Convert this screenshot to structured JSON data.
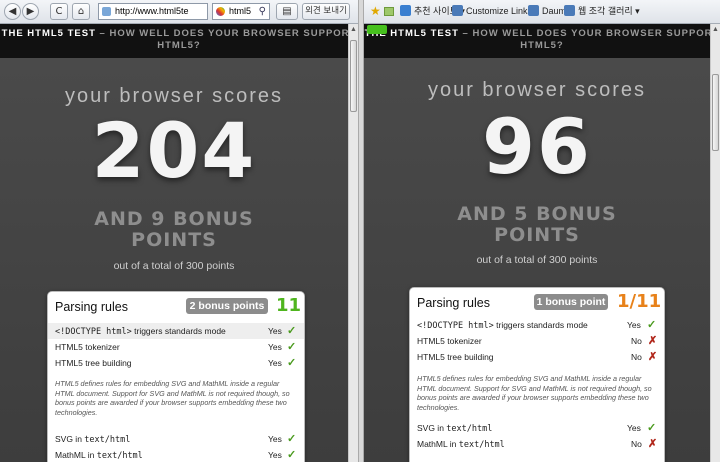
{
  "colors": {
    "green": "#4fb51e",
    "orange": "#e8821a",
    "cross": "#b1271b",
    "check": "#4a9a1e"
  },
  "left": {
    "toolbar": {
      "back": "◀",
      "forward": "▶",
      "refresh": "C",
      "home": "⌂",
      "address": "http://www.html5te",
      "search": "html5",
      "page_menu": "외견 보내기"
    },
    "banner": {
      "strong": "THE HTML5 TEST",
      "rest": " – HOW WELL DOES YOUR BROWSER SUPPORT HTML5?"
    },
    "scores_label": "your browser scores",
    "score": "204",
    "bonus_line1": "AND 9 BONUS",
    "bonus_line2": "POINTS",
    "total": "out of a total of 300 points",
    "card": {
      "title": "Parsing rules",
      "bonus_badge": "2 bonus points",
      "score": "11",
      "rows": [
        {
          "label_code": "<!DOCTYPE html>",
          "label_rest": " triggers standards mode",
          "result": "Yes",
          "mark": "✓"
        },
        {
          "label": "HTML5 tokenizer",
          "result": "Yes",
          "mark": "✓"
        },
        {
          "label": "HTML5 tree building",
          "result": "Yes",
          "mark": "✓"
        }
      ],
      "note": "HTML5 defines rules for embedding SVG and MathML inside a regular HTML document. Support for SVG and MathML is not required though, so bonus points are awarded if your browser supports embedding these two technologies.",
      "rows2": [
        {
          "label_pre": "SVG in ",
          "label_code": "text/html",
          "result": "Yes",
          "mark": "✓"
        },
        {
          "label_pre": "MathML in ",
          "label_code": "text/html",
          "result": "Yes",
          "mark": "✓"
        }
      ]
    }
  },
  "right": {
    "favorites": [
      {
        "label": "추천 사이트 ▾",
        "icon_color": "#3a7fd0"
      },
      {
        "label": "Customize Links",
        "icon_color": "#4a7ab8"
      },
      {
        "label": "Daum",
        "icon_color": "#4a7ab8"
      },
      {
        "label": "웹 조각 갤러리 ▾",
        "icon_color": "#4a7ab8"
      }
    ],
    "banner": {
      "strong": "THE HTML5 TEST",
      "rest": " – HOW WELL DOES YOUR BROWSER SUPPORT HTML5?"
    },
    "scores_label": "your browser scores",
    "score": "96",
    "bonus_line1": "AND 5 BONUS",
    "bonus_line2": "POINTS",
    "total": "out of a total of 300 points",
    "card": {
      "title": "Parsing rules",
      "bonus_badge": "1 bonus point",
      "score": "1/11",
      "rows": [
        {
          "label_code": "<!DOCTYPE html>",
          "label_rest": " triggers standards mode",
          "result": "Yes",
          "mark": "✓"
        },
        {
          "label": "HTML5 tokenizer",
          "result": "No",
          "mark": "✗"
        },
        {
          "label": "HTML5 tree building",
          "result": "No",
          "mark": "✗"
        }
      ],
      "note": "HTML5 defines rules for embedding SVG and MathML inside a regular HTML document. Support for SVG and MathML is not required though, so bonus points are awarded if your browser supports embedding these two technologies.",
      "rows2": [
        {
          "label_pre": "SVG in ",
          "label_code": "text/html",
          "result": "Yes",
          "mark": "✓"
        },
        {
          "label_pre": "MathML in ",
          "label_code": "text/html",
          "result": "No",
          "mark": "✗"
        }
      ]
    }
  }
}
